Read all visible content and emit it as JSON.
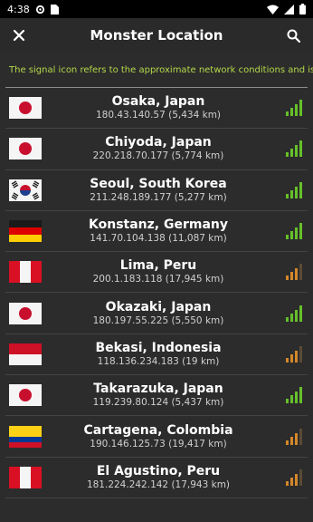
{
  "status": {
    "time": "4:38"
  },
  "appbar": {
    "title": "Monster Location"
  },
  "notice": "The signal icon refers to the approximate network conditions and is not",
  "colors": {
    "good_signal": "#66c02a",
    "weak_signal": "#d4872a",
    "weak_signal_dim": "#5a4a35",
    "notice_text": "#b4d84a"
  },
  "locations": [
    {
      "name": "Osaka, Japan",
      "detail": "180.43.140.57 (5,434 km)",
      "flag": "japan",
      "signal": "good"
    },
    {
      "name": "Chiyoda, Japan",
      "detail": "220.218.70.177 (5,774 km)",
      "flag": "japan",
      "signal": "good"
    },
    {
      "name": "Seoul, South Korea",
      "detail": "211.248.189.177 (5,277 km)",
      "flag": "south-korea",
      "signal": "good"
    },
    {
      "name": "Konstanz, Germany",
      "detail": "141.70.104.138 (11,087 km)",
      "flag": "germany",
      "signal": "good"
    },
    {
      "name": "Lima, Peru",
      "detail": "200.1.183.118 (17,945 km)",
      "flag": "peru",
      "signal": "weak"
    },
    {
      "name": "Okazaki, Japan",
      "detail": "180.197.55.225 (5,550 km)",
      "flag": "japan",
      "signal": "good"
    },
    {
      "name": "Bekasi, Indonesia",
      "detail": "118.136.234.183 (19 km)",
      "flag": "indonesia",
      "signal": "weak"
    },
    {
      "name": "Takarazuka, Japan",
      "detail": "119.239.80.124 (5,437 km)",
      "flag": "japan",
      "signal": "good"
    },
    {
      "name": "Cartagena, Colombia",
      "detail": "190.146.125.73 (19,417 km)",
      "flag": "colombia",
      "signal": "weak"
    },
    {
      "name": "El Agustino, Peru",
      "detail": "181.224.242.142 (17,943 km)",
      "flag": "peru",
      "signal": "weak"
    }
  ]
}
